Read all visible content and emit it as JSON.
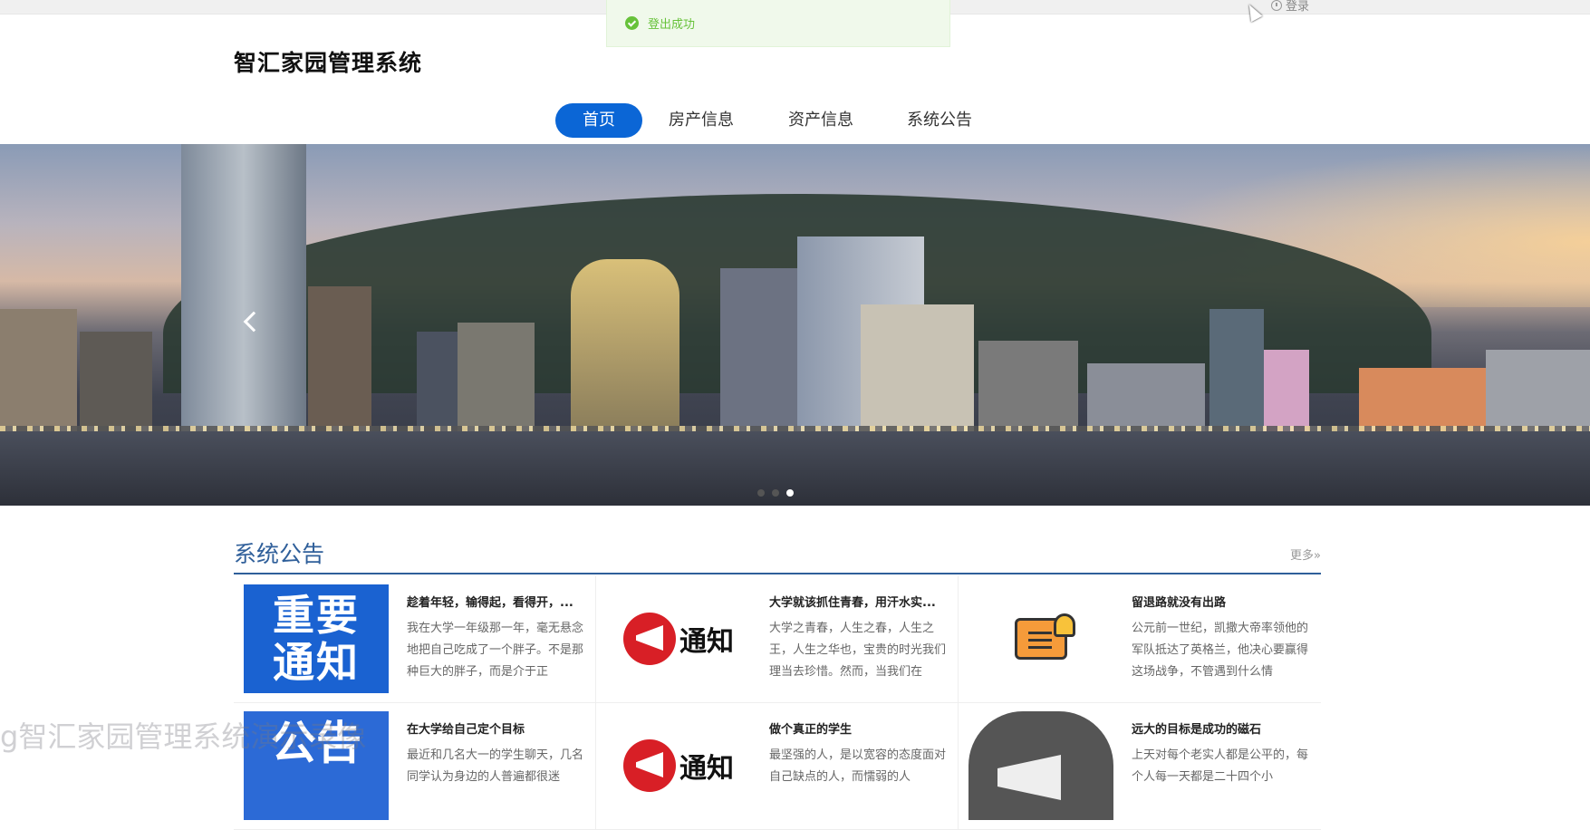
{
  "topbar": {
    "login_label": "登录"
  },
  "toast": {
    "message": "登出成功"
  },
  "header": {
    "site_title": "智汇家园管理系统"
  },
  "nav": {
    "items": [
      {
        "label": "首页",
        "active": true
      },
      {
        "label": "房产信息",
        "active": false
      },
      {
        "label": "资产信息",
        "active": false
      },
      {
        "label": "系统公告",
        "active": false
      }
    ]
  },
  "banner": {
    "dots": 3,
    "active_dot": 3
  },
  "announcements": {
    "section_title": "系统公告",
    "more_label": "更多»",
    "items": [
      {
        "title": "趁着年轻，输得起，看得开，...",
        "desc": "我在大学一年级那一年，毫无悬念地把自己吃成了一个胖子。不是那种巨大的胖子，而是介于正",
        "thumb_text": "重要通知"
      },
      {
        "title": "大学就该抓住青春，用汗水实...",
        "desc": "大学之青春，人生之春，人生之王，人生之华也，宝贵的时光我们理当去珍惜。然而，当我们在",
        "thumb_text": "通知"
      },
      {
        "title": "留退路就没有出路",
        "desc": "公元前一世纪，凯撒大帝率领他的军队抵达了英格兰，他决心要赢得这场战争，不管遇到什么情",
        "thumb_text": ""
      },
      {
        "title": "在大学给自己定个目标",
        "desc": "最近和几名大一的学生聊天，几名同学认为身边的人普遍都很迷",
        "thumb_text": "公告"
      },
      {
        "title": "做个真正的学生",
        "desc": "最坚强的人，是以宽容的态度面对自己缺点的人，而懦弱的人",
        "thumb_text": "通知"
      },
      {
        "title": "远大的目标是成功的磁石",
        "desc": "上天对每个老实人都是公平的，每个人每一天都是二十四个小",
        "thumb_text": ""
      }
    ]
  },
  "watermark": {
    "text": "g智汇家园管理系统演示录像"
  },
  "colors": {
    "nav_active": "#0b66d6",
    "section_title": "#2f5f9a",
    "toast_green": "#67c23a"
  }
}
